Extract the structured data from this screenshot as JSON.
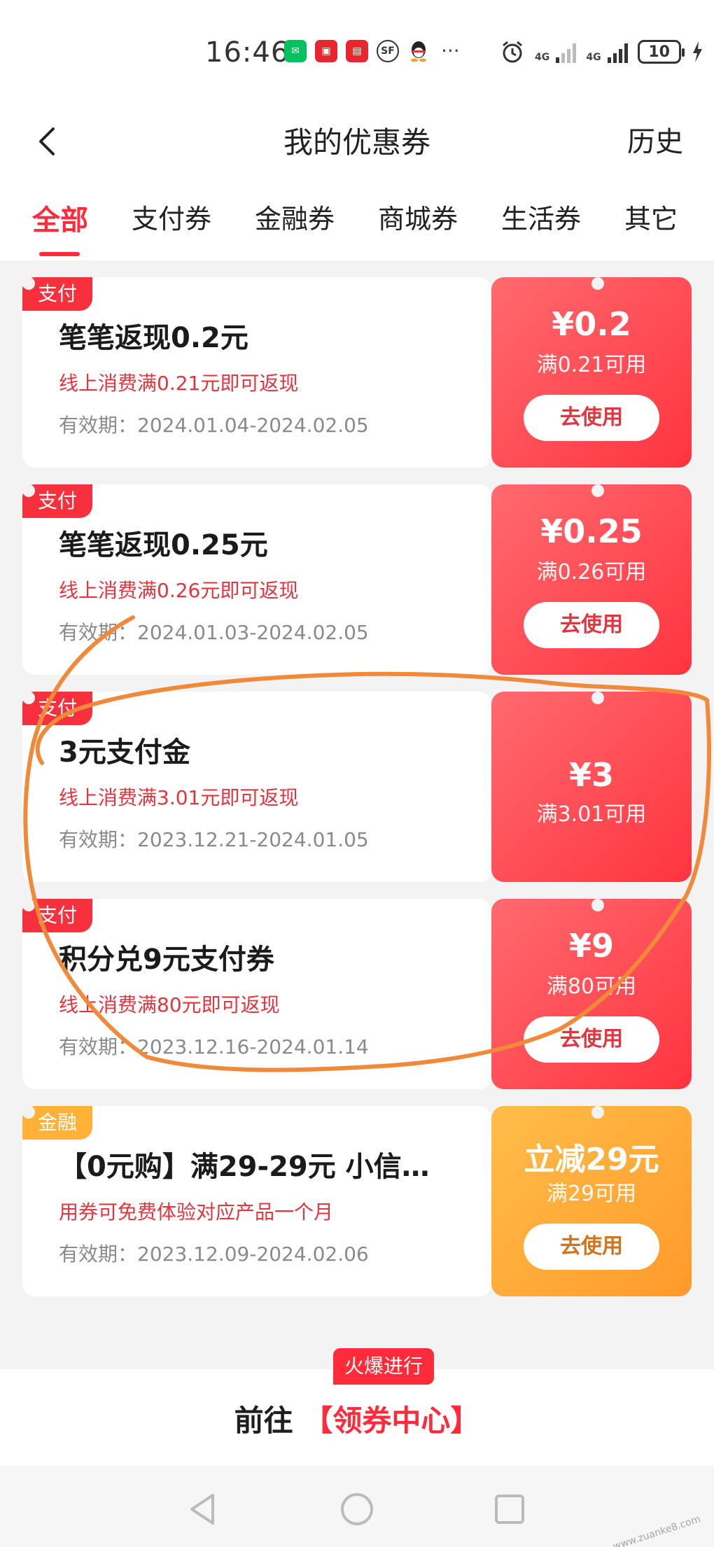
{
  "status_bar": {
    "time": "16:46",
    "app_icons": [
      "wechat-icon",
      "app-icon",
      "app-icon",
      "sf-express-icon",
      "qq-icon"
    ],
    "more": "···",
    "network1": "4G",
    "network2": "4G",
    "battery": "10"
  },
  "header": {
    "title": "我的优惠券",
    "history": "历史"
  },
  "tabs": [
    {
      "label": "全部"
    },
    {
      "label": "支付券"
    },
    {
      "label": "金融券"
    },
    {
      "label": "商城券"
    },
    {
      "label": "生活券"
    },
    {
      "label": "其它"
    }
  ],
  "coupons": [
    {
      "tag": "支付",
      "title": "笔笔返现0.2元",
      "desc": "线上消费满0.21元即可返现",
      "valid": "有效期：2024.01.04-2024.02.05",
      "amount": "¥0.2",
      "condition": "满0.21可用",
      "button": "去使用"
    },
    {
      "tag": "支付",
      "title": "笔笔返现0.25元",
      "desc": "线上消费满0.26元即可返现",
      "valid": "有效期：2024.01.03-2024.02.05",
      "amount": "¥0.25",
      "condition": "满0.26可用",
      "button": "去使用"
    },
    {
      "tag": "支付",
      "title": "3元支付金",
      "desc": "线上消费满3.01元即可返现",
      "valid": "有效期：2023.12.21-2024.01.05",
      "amount": "¥3",
      "condition": "满3.01可用"
    },
    {
      "tag": "支付",
      "title": "积分兑9元支付券",
      "desc": "线上消费满80元即可返现",
      "valid": "有效期：2023.12.16-2024.01.14",
      "amount": "¥9",
      "condition": "满80可用",
      "button": "去使用"
    },
    {
      "tag": "金融",
      "title": "【0元购】满29-29元 小信…",
      "desc": "用券可免费体验对应产品一个月",
      "valid": "有效期：2023.12.09-2024.02.06",
      "amount": "立减29元",
      "condition": "满29可用",
      "button": "去使用"
    }
  ],
  "cta": {
    "badge": "火爆进行",
    "prefix": "前往",
    "link": "【领券中心】"
  },
  "watermark": "www.zuanke8.com",
  "colors": {
    "accent": "#ff2a3a",
    "coupon_red": "#ff3440",
    "coupon_gold": "#ff9a2a",
    "annotation": "#f08a3a"
  }
}
